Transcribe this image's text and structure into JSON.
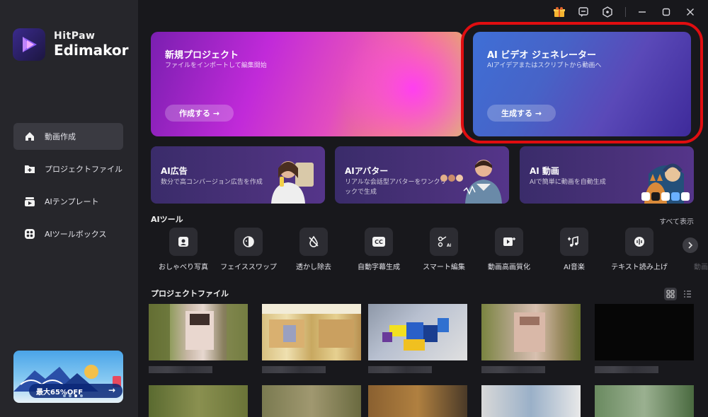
{
  "app": {
    "brand_top": "HitPaw",
    "brand_bottom": "Edimakor"
  },
  "colors": {
    "highlight_ring": "#e00d10",
    "sidebar_bg": "#26262b",
    "main_bg": "#18181c"
  },
  "sidebar": {
    "items": [
      {
        "label": "動画作成",
        "icon": "home-icon",
        "active": true
      },
      {
        "label": "プロジェクトファイル",
        "icon": "folder-icon",
        "active": false
      },
      {
        "label": "AIテンプレート",
        "icon": "template-icon",
        "active": false
      },
      {
        "label": "AIツールボックス",
        "icon": "toolbox-icon",
        "active": false
      }
    ],
    "promo": {
      "label": "最大65%OFF",
      "arrow": "→"
    }
  },
  "titlebar": {
    "icons": [
      "gift-icon",
      "feedback-icon",
      "settings-icon",
      "minimize-icon",
      "maximize-icon",
      "close-icon"
    ]
  },
  "hero": {
    "new_project": {
      "title": "新規プロジェクト",
      "subtitle": "ファイルをインポートして編集開始",
      "button": "作成する →"
    },
    "ai_video": {
      "title": "AI ビデオ ジェネレーター",
      "subtitle": "AIアイデアまたはスクリプトから動画へ",
      "button": "生成する →"
    }
  },
  "features": [
    {
      "title": "AI広告",
      "subtitle": "数分で高コンバージョン広告を作成"
    },
    {
      "title": "AIアバター",
      "subtitle": "リアルな会話型アバターをワンクリックで生成"
    },
    {
      "title": "AI 動画",
      "subtitle": "AIで簡単に動画を自動生成"
    }
  ],
  "ai_tools": {
    "title": "AIツール",
    "show_all": "すべて表示",
    "items": [
      {
        "label": "おしゃべり写真",
        "icon": "talking-photo-icon"
      },
      {
        "label": "フェイススワップ",
        "icon": "face-swap-icon"
      },
      {
        "label": "透かし除去",
        "icon": "watermark-remove-icon"
      },
      {
        "label": "自動字幕生成",
        "icon": "subtitle-cc-icon"
      },
      {
        "label": "スマート編集",
        "icon": "smart-edit-icon"
      },
      {
        "label": "動画高画質化",
        "icon": "video-enhance-icon"
      },
      {
        "label": "AI音楽",
        "icon": "music-icon"
      },
      {
        "label": "テキスト読み上げ",
        "icon": "text-to-speech-icon"
      },
      {
        "label": "動画画",
        "icon": "faded-icon"
      }
    ]
  },
  "projects": {
    "title": "プロジェクトファイル"
  }
}
